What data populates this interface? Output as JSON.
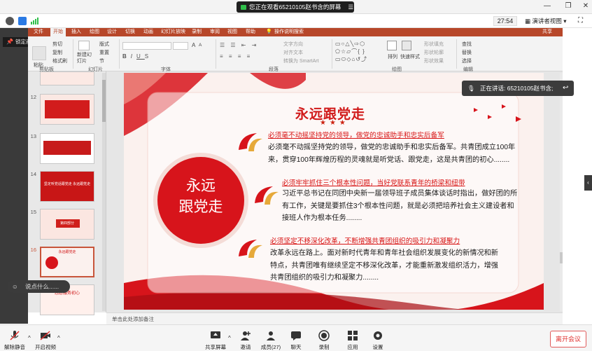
{
  "meeting": {
    "share_banner": "您正在观看65210105赵书含的屏幕",
    "timer": "27:54",
    "view_mode": "演讲者视图",
    "speaking": "正在讲话: 65210105赵书含;",
    "chat_placeholder": "说点什么......",
    "lock_screen": "锁定画面"
  },
  "ribbon": {
    "tabs": [
      "文件",
      "开始",
      "插入",
      "绘图",
      "设计",
      "切换",
      "动画",
      "幻灯片放映",
      "录制",
      "审阅",
      "视图",
      "帮助",
      "操作说明搜索"
    ],
    "active_tab": "开始",
    "share": "共享",
    "clipboard": {
      "cut": "剪切",
      "copy": "复制",
      "format_painter": "格式刷",
      "paste": "粘贴",
      "group": "剪贴板"
    },
    "slides": {
      "new_slide": "新建幻灯片",
      "layout": "版式",
      "reset": "重置",
      "section": "节",
      "group": "幻灯片"
    },
    "font": {
      "group": "字体",
      "size_up": "A",
      "size_down": "A"
    },
    "paragraph": {
      "text_direction": "文字方向",
      "align_text": "对齐文本",
      "smartart": "转换为 SmartArt",
      "group": "段落"
    },
    "drawing": {
      "arrange": "排列",
      "quick_styles": "快速样式",
      "shape_fill": "形状填充",
      "shape_outline": "形状轮廓",
      "shape_effects": "形状效果",
      "group": "绘图"
    },
    "editing": {
      "find": "查找",
      "replace": "替换",
      "select": "选择",
      "group": "编辑"
    }
  },
  "thumbnails": [
    {
      "num": "12",
      "label": ""
    },
    {
      "num": "13",
      "label": ""
    },
    {
      "num": "14",
      "label": "坚定听党话跟党走 永远跟党走"
    },
    {
      "num": "15",
      "label": "第四部分"
    },
    {
      "num": "16",
      "label": "永远跟党走"
    },
    {
      "num": "",
      "label": "志愿服务初心"
    }
  ],
  "slide": {
    "title": "永远跟党走",
    "stars": "★★★",
    "circle_text_1": "永远",
    "circle_text_2": "跟党走",
    "sections": [
      {
        "heading": "必须毫不动摇坚持党的领导，做党的忠诚助手和忠实后备军",
        "lines": [
          "必须毫不动摇坚持党的领导，做党的忠诚助手和忠实后备军。共青团成立100年",
          "来，贯穿100年辉煌历程的灵魂就是听党话、跟党走，这是共青团的初心........"
        ]
      },
      {
        "heading": "必须牢牢抓住三个根本性问题，当好党联系青年的桥梁和纽带",
        "lines": [
          "习近平总书记在同团中央新一届领导班子成员集体谈话时指出，做好团的所",
          "有工作，关键是要抓住3个根本性问题，就是必须把培养社会主义建设者和",
          "接班人作为根本任务........"
        ]
      },
      {
        "heading": "必须坚定不移深化改革，不断增强共青团组织的吸引力和凝聚力",
        "lines": [
          "改革永远在路上。面对新时代青年和青年社会组织发展变化的新情况和新",
          "特点，共青团唯有继续坚定不移深化改革，才能重新激发组织活力，增强",
          "共青团组织的吸引力和凝聚力........"
        ]
      }
    ]
  },
  "notes_placeholder": "单击此处添加备注",
  "toolbar": {
    "mute": "解除静音",
    "video": "开启视频",
    "share": "共享屏幕",
    "invite": "邀请",
    "members": "成员(27)",
    "chat": "聊天",
    "record": "录制",
    "apps": "应用",
    "settings": "设置",
    "leave": "离开会议"
  },
  "colors": {
    "ppt_red": "#b7472a",
    "slide_red": "#d7141b",
    "leave_red": "#e0312f"
  }
}
